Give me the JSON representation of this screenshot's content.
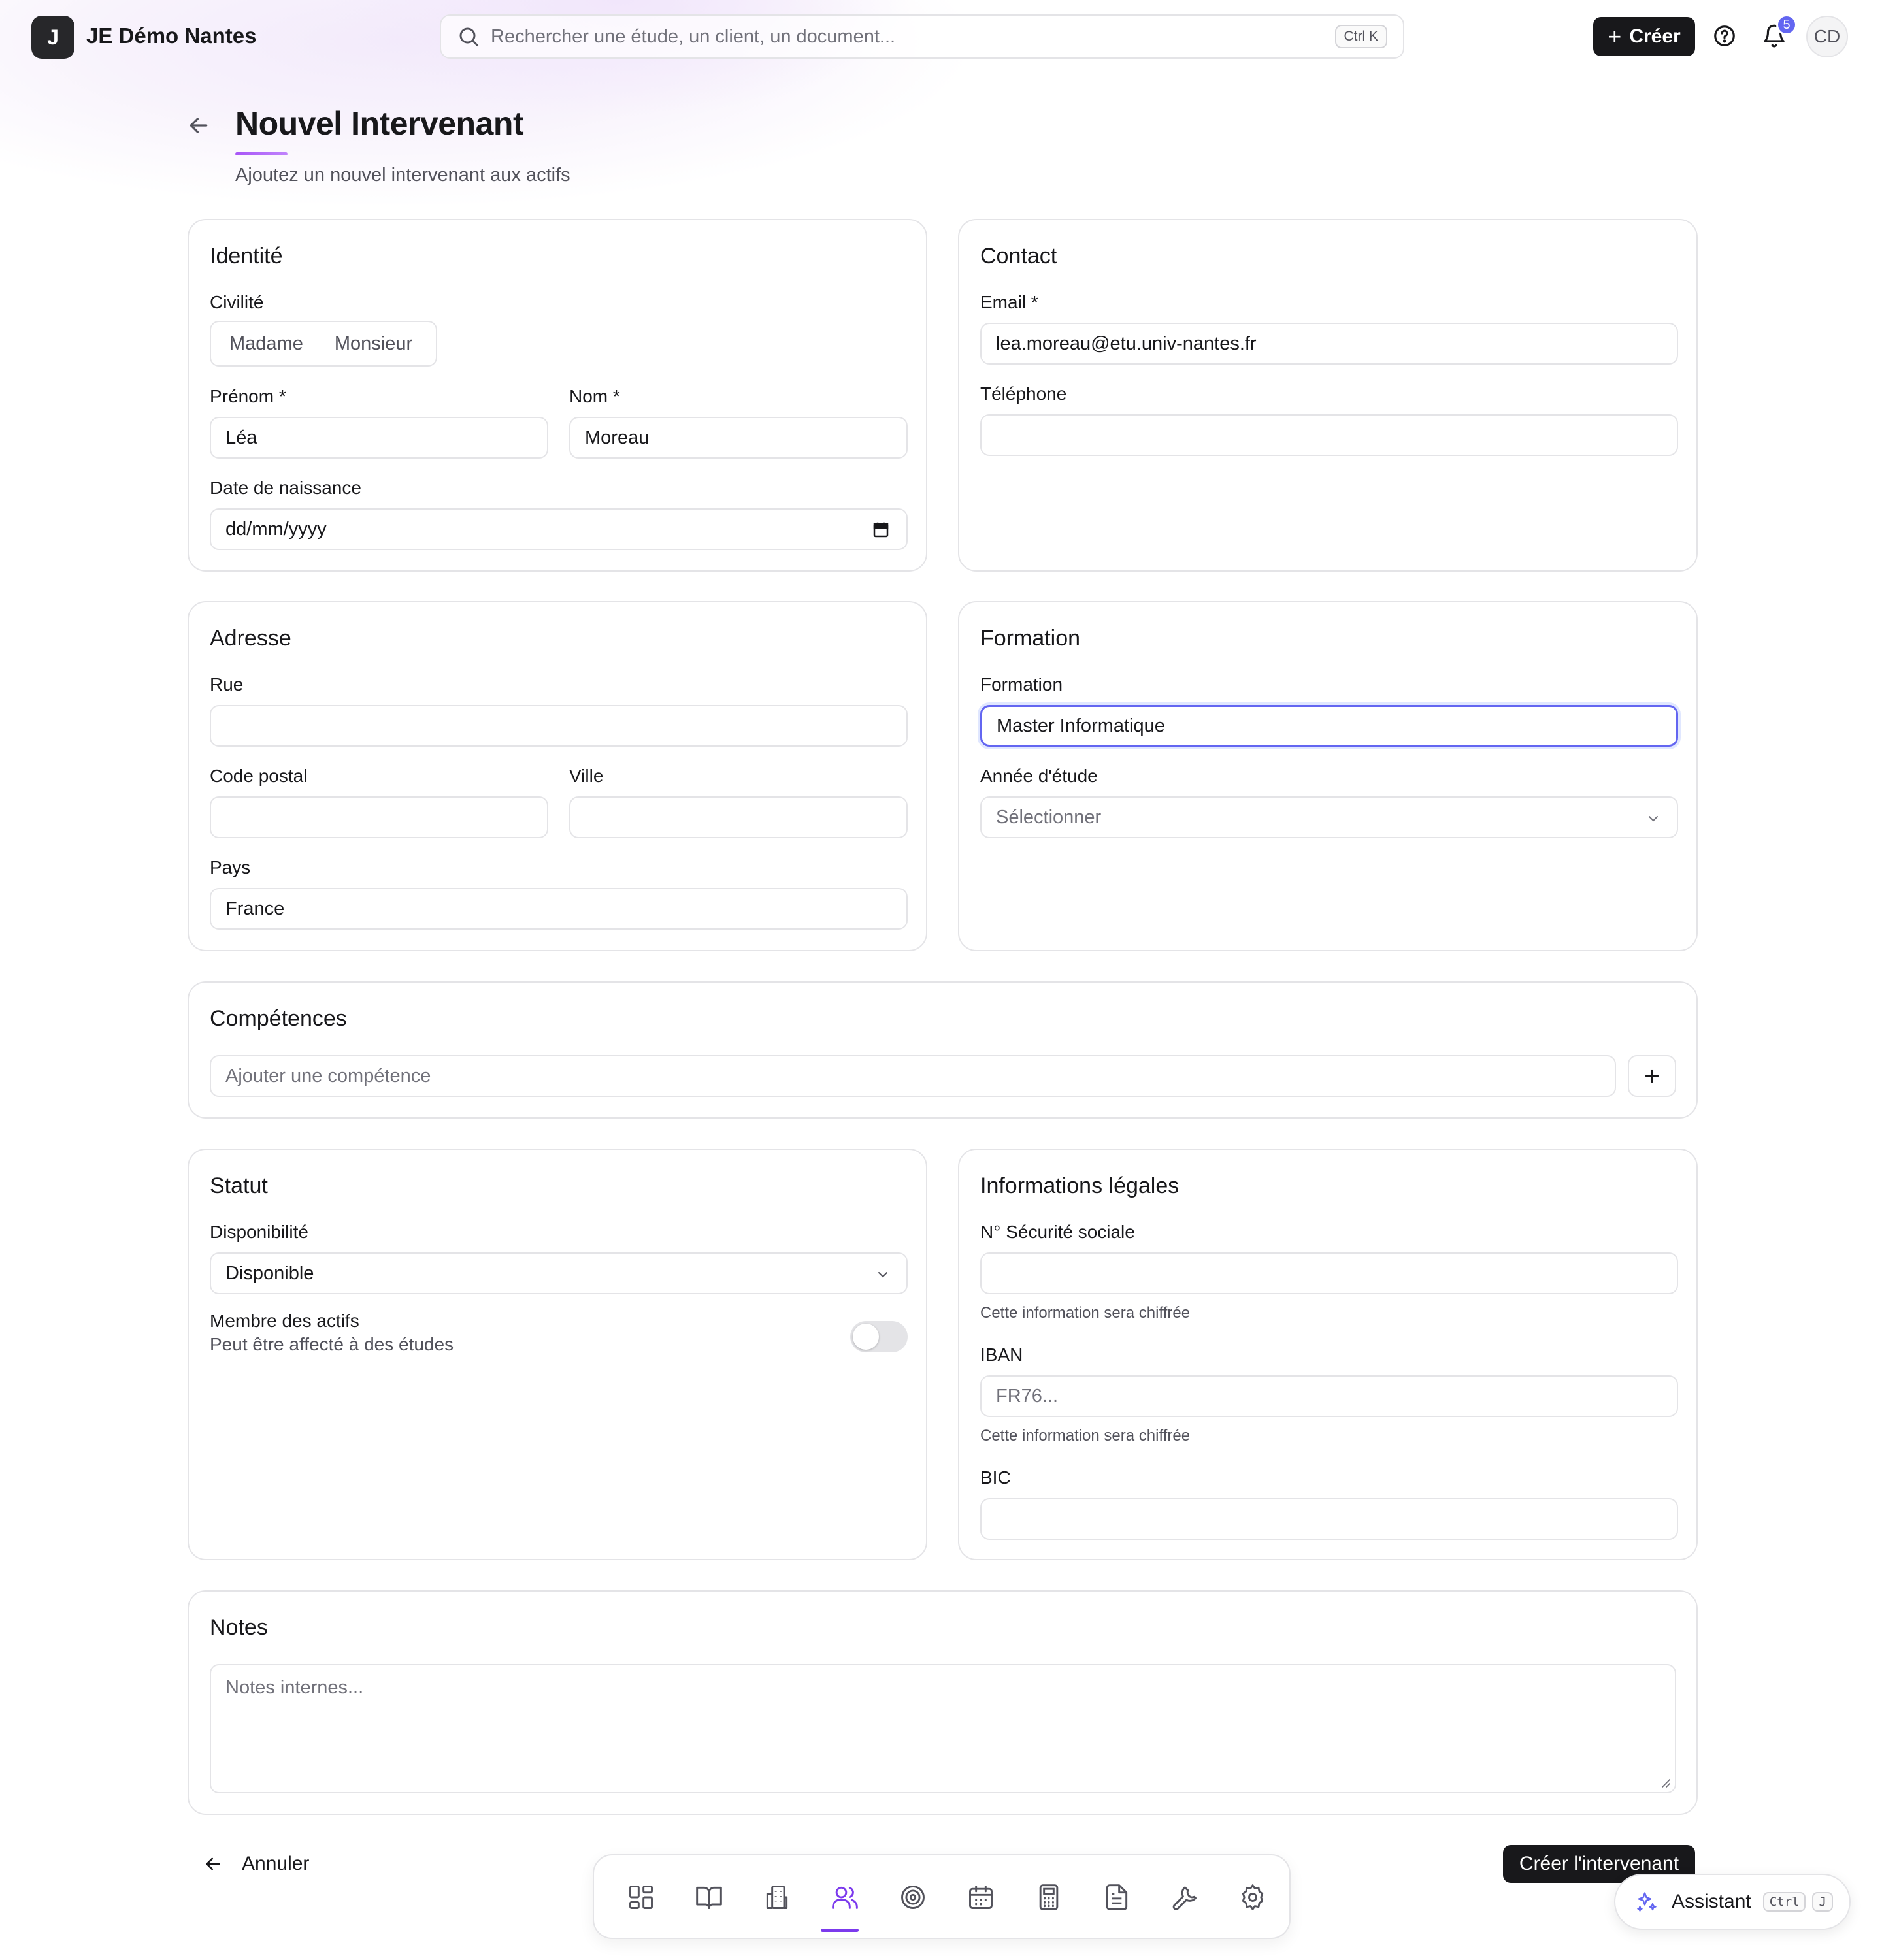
{
  "app": {
    "logo_letter": "J",
    "name": "JE Démo Nantes"
  },
  "search": {
    "placeholder": "Rechercher une étude, un client, un document...",
    "shortcut": "Ctrl K"
  },
  "topbar": {
    "create_label": "Créer",
    "notification_count": "5",
    "avatar_initials": "CD"
  },
  "header": {
    "title": "Nouvel Intervenant",
    "subtitle": "Ajoutez un nouvel intervenant aux actifs"
  },
  "identite": {
    "title": "Identité",
    "civilite_label": "Civilité",
    "civilite_options": [
      "Madame",
      "Monsieur"
    ],
    "prenom_label": "Prénom *",
    "prenom_value": "Léa",
    "nom_label": "Nom *",
    "nom_value": "Moreau",
    "naissance_label": "Date de naissance",
    "naissance_placeholder": "dd/mm/yyyy"
  },
  "contact": {
    "title": "Contact",
    "email_label": "Email *",
    "email_value": "lea.moreau@etu.univ-nantes.fr",
    "telephone_label": "Téléphone",
    "telephone_value": ""
  },
  "adresse": {
    "title": "Adresse",
    "rue_label": "Rue",
    "rue_value": "",
    "cp_label": "Code postal",
    "cp_value": "",
    "ville_label": "Ville",
    "ville_value": "",
    "pays_label": "Pays",
    "pays_value": "France"
  },
  "formation": {
    "title": "Formation",
    "formation_label": "Formation",
    "formation_value": "Master Informatique",
    "annee_label": "Année d'étude",
    "annee_placeholder": "Sélectionner"
  },
  "competences": {
    "title": "Compétences",
    "placeholder": "Ajouter une compétence"
  },
  "statut": {
    "title": "Statut",
    "dispo_label": "Disponibilité",
    "dispo_value": "Disponible",
    "membre_label": "Membre des actifs",
    "membre_help": "Peut être affecté à des études",
    "membre_enabled": false
  },
  "legal": {
    "title": "Informations légales",
    "secu_label": "N° Sécurité sociale",
    "secu_value": "",
    "secu_help": "Cette information sera chiffrée",
    "iban_label": "IBAN",
    "iban_placeholder": "FR76...",
    "iban_help": "Cette information sera chiffrée",
    "bic_label": "BIC",
    "bic_value": ""
  },
  "notes": {
    "title": "Notes",
    "placeholder": "Notes internes..."
  },
  "footer": {
    "cancel_label": "Annuler",
    "submit_label": "Créer l'intervenant"
  },
  "dock": {
    "items": [
      "dashboard-icon",
      "book-icon",
      "building-icon",
      "users-icon",
      "target-icon",
      "calendar-icon",
      "calculator-icon",
      "document-icon",
      "wrench-icon",
      "settings-icon"
    ],
    "active": "users-icon"
  },
  "assistant": {
    "label": "Assistant",
    "key1": "Ctrl",
    "key2": "J"
  },
  "colors": {
    "accent": "#6366f1",
    "active_nav": "#7c3aed",
    "primary_button": "#18181b"
  }
}
